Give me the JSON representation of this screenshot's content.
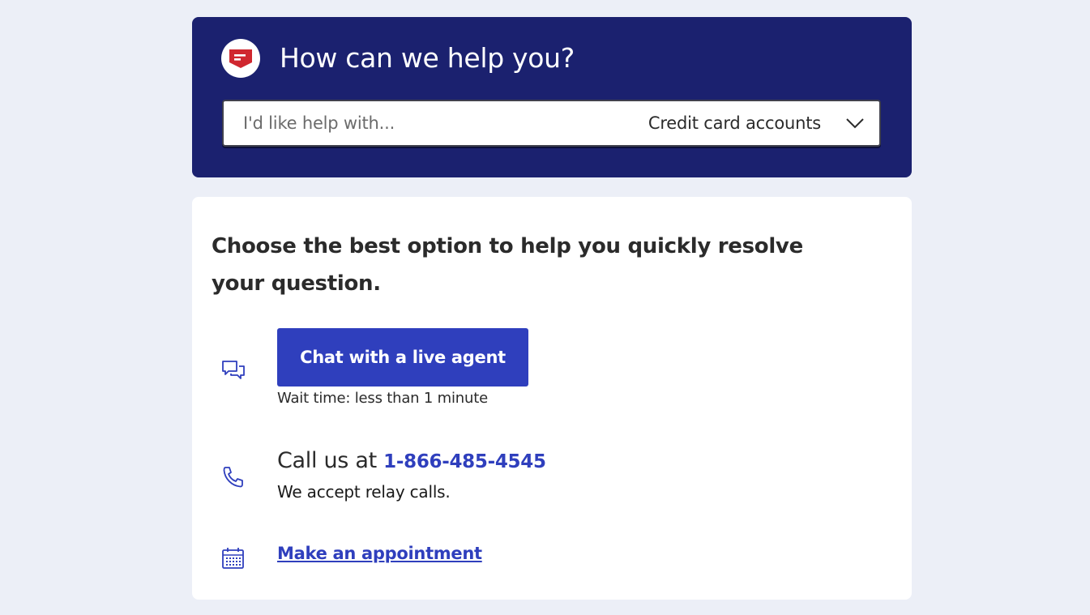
{
  "help": {
    "title": "How can we help you?",
    "select": {
      "placeholder": "I'd like help with...",
      "value": "Credit card accounts"
    }
  },
  "options": {
    "heading": "Choose the best option to help you quickly resolve your question.",
    "chat": {
      "button_label": "Chat with a live agent",
      "wait_time": "Wait time: less than 1 minute"
    },
    "call": {
      "prefix": "Call us at ",
      "phone": "1-866-485-4545",
      "relay_note": "We accept relay calls."
    },
    "appointment": {
      "link_label": "Make an appointment"
    }
  },
  "icons": {
    "logo": "chat-bubble-logo-icon",
    "chevron": "chevron-down-icon",
    "chat": "chat-bubbles-icon",
    "phone": "phone-icon",
    "calendar": "calendar-icon"
  },
  "colors": {
    "header_bg": "#1b216f",
    "accent": "#2f3fbd",
    "logo_red": "#d0272f",
    "page_bg": "#eceff7"
  }
}
